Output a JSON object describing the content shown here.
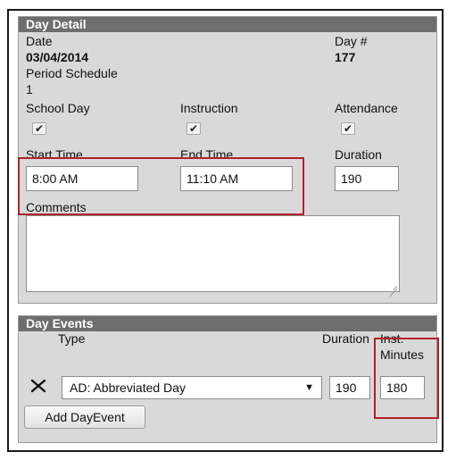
{
  "day_detail": {
    "header": "Day Detail",
    "date_label": "Date",
    "date_value": "03/04/2014",
    "day_num_label": "Day #",
    "day_num_value": "177",
    "period_schedule_label": "Period Schedule",
    "period_schedule_value": "1",
    "school_day_label": "School Day",
    "instruction_label": "Instruction",
    "attendance_label": "Attendance",
    "school_day_checked": true,
    "instruction_checked": true,
    "attendance_checked": true,
    "start_time_label": "Start Time",
    "start_time_value": "8:00 AM",
    "end_time_label": "End Time",
    "end_time_value": "11:10 AM",
    "duration_label": "Duration",
    "duration_value": "190",
    "comments_label": "Comments",
    "comments_value": ""
  },
  "day_events": {
    "header": "Day Events",
    "type_label": "Type",
    "duration_label": "Duration",
    "inst_minutes_label_1": "Inst.",
    "inst_minutes_label_2": "Minutes",
    "rows": [
      {
        "type_value": "AD: Abbreviated Day",
        "duration_value": "190",
        "inst_minutes_value": "180"
      }
    ],
    "add_button_label": "Add DayEvent"
  },
  "icons": {
    "delete": "x-icon",
    "dropdown": "chevron-down-icon",
    "check": "checkmark-icon"
  },
  "colors": {
    "panel_header": "#6e6e6e",
    "panel_bg": "#d9d9d9",
    "highlight": "#b3202a"
  }
}
